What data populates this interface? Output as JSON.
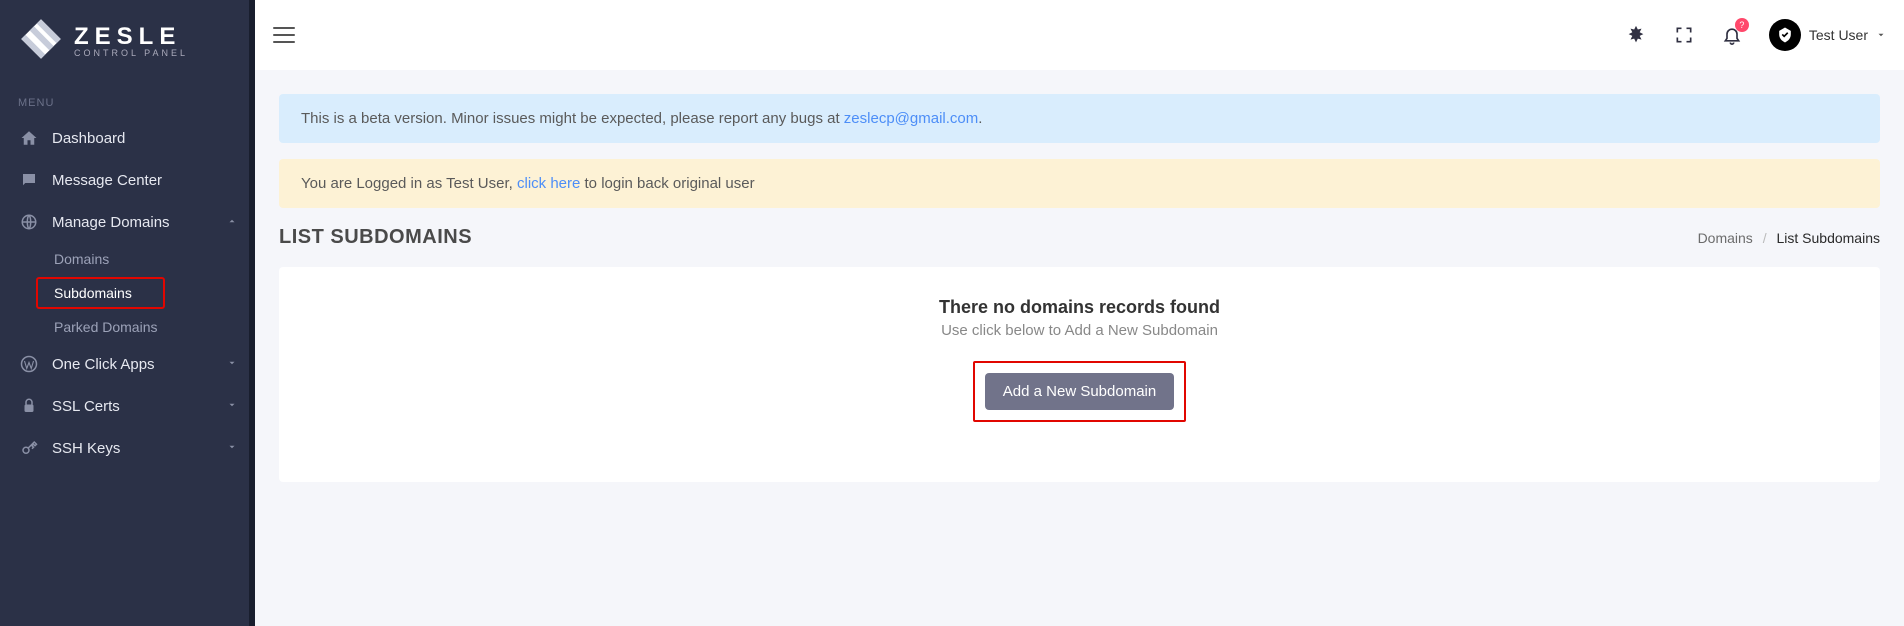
{
  "logo": {
    "title": "ZESLE",
    "subtitle": "CONTROL PANEL"
  },
  "sidebar": {
    "heading": "MENU",
    "dashboard": "Dashboard",
    "message_center": "Message Center",
    "manage_domains": "Manage Domains",
    "sub_domains": "Domains",
    "sub_subdomains": "Subdomains",
    "sub_parked": "Parked Domains",
    "one_click": "One Click Apps",
    "ssl": "SSL Certs",
    "ssh": "SSH Keys"
  },
  "topbar": {
    "user_name": "Test User",
    "notif_badge": "?"
  },
  "alerts": {
    "beta_pre": "This is a beta version. Minor issues might be expected, please report any bugs at ",
    "beta_email": "zeslecp@gmail.com",
    "beta_post": ".",
    "login_pre": "You are Logged in as Test User, ",
    "login_link": "click here",
    "login_post": " to login back original user"
  },
  "page": {
    "title": "LIST SUBDOMAINS",
    "breadcrumb_root": "Domains",
    "breadcrumb_current": "List Subdomains"
  },
  "card": {
    "heading": "There no domains records found",
    "sub": "Use click below to Add a New Subdomain",
    "button": "Add a New Subdomain"
  }
}
